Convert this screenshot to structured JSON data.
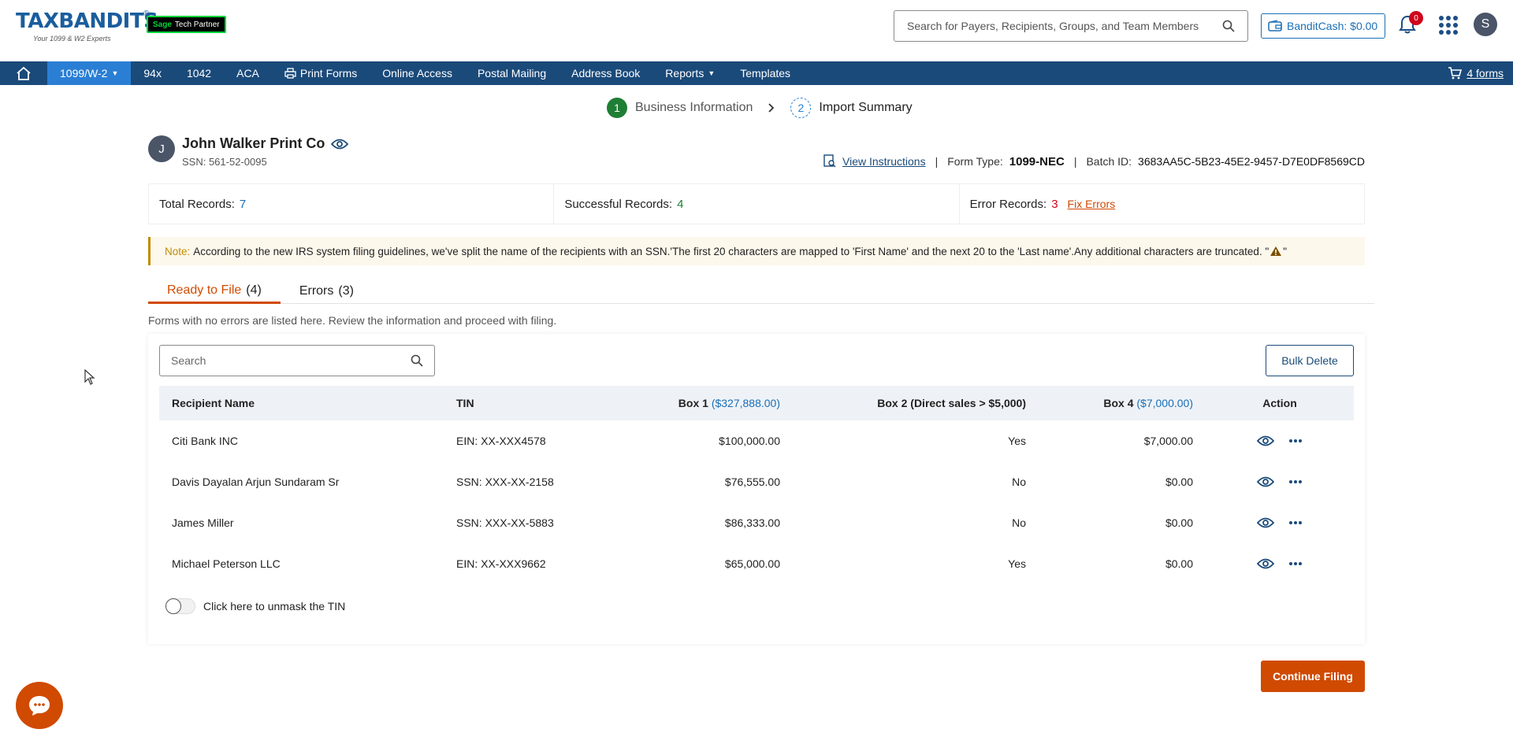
{
  "header": {
    "logo_text": "TAXBANDITS",
    "logo_tagline": "Your 1099 & W2 Experts",
    "partner_badge": {
      "brand": "Sage",
      "text": "Tech Partner"
    },
    "search_placeholder": "Search for Payers, Recipients, Groups, and Team Members",
    "bandit_cash": "BanditCash: $0.00",
    "notification_count": "0",
    "user_initial": "S"
  },
  "nav": {
    "items": [
      {
        "label": "1099/W-2",
        "active": true,
        "dropdown": true
      },
      {
        "label": "94x"
      },
      {
        "label": "1042"
      },
      {
        "label": "ACA"
      },
      {
        "label": "Print Forms",
        "icon": "printer-icon"
      },
      {
        "label": "Online Access"
      },
      {
        "label": "Postal Mailing"
      },
      {
        "label": "Address Book"
      },
      {
        "label": "Reports",
        "dropdown": true
      },
      {
        "label": "Templates"
      }
    ],
    "cart_label": "4 forms"
  },
  "stepper": {
    "steps": [
      {
        "num": "1",
        "label": "Business Information",
        "state": "done"
      },
      {
        "num": "2",
        "label": "Import Summary",
        "state": "current"
      }
    ]
  },
  "business": {
    "initial": "J",
    "name": "John Walker Print Co",
    "ssn": "SSN: 561-52-0095",
    "view_instructions": "View Instructions",
    "form_type_label": "Form Type:",
    "form_type": "1099-NEC",
    "batch_label": "Batch ID:",
    "batch_id": "3683AA5C-5B23-45E2-9457-D7E0DF8569CD"
  },
  "summary": {
    "total_label": "Total Records:",
    "total": "7",
    "success_label": "Successful Records:",
    "success": "4",
    "error_label": "Error Records:",
    "errors": "3",
    "fix_errors": "Fix Errors"
  },
  "note": {
    "label": "Note:",
    "text": "According to the new IRS system filing guidelines, we've split the name of the recipients with an SSN.'The first 20 characters are mapped to 'First Name' and the next 20 to the 'Last name'.Any additional characters are truncated. \"",
    "suffix": "\""
  },
  "tabs": [
    {
      "label": "Ready to File",
      "count": "(4)",
      "active": true
    },
    {
      "label": "Errors",
      "count": "(3)"
    }
  ],
  "help_text": "Forms with no errors are listed here. Review the information and proceed with filing.",
  "table": {
    "search_placeholder": "Search",
    "bulk_delete": "Bulk Delete",
    "headers": {
      "name": "Recipient Name",
      "tin": "TIN",
      "box1": "Box 1",
      "box1_amt": "($327,888.00)",
      "box2": "Box 2 (Direct sales > $5,000)",
      "box4": "Box 4",
      "box4_amt": "($7,000.00)",
      "action": "Action"
    },
    "rows": [
      {
        "name": "Citi Bank INC",
        "tin": "EIN: XX-XXX4578",
        "box1": "$100,000.00",
        "box2": "Yes",
        "box4": "$7,000.00"
      },
      {
        "name": "Davis Dayalan Arjun Sundaram Sr",
        "tin": "SSN: XXX-XX-2158",
        "box1": "$76,555.00",
        "box2": "No",
        "box4": "$0.00"
      },
      {
        "name": "James Miller",
        "tin": "SSN: XXX-XX-5883",
        "box1": "$86,333.00",
        "box2": "No",
        "box4": "$0.00"
      },
      {
        "name": "Michael Peterson LLC",
        "tin": "EIN: XX-XXX9662",
        "box1": "$65,000.00",
        "box2": "Yes",
        "box4": "$0.00"
      }
    ],
    "unmask_label": "Click here to unmask the TIN"
  },
  "continue_label": "Continue Filing",
  "colors": {
    "nav_bg": "#1a4a7a",
    "nav_active": "#2a7fd4",
    "accent_orange": "#d04a02",
    "success_green": "#1e7e34",
    "error_red": "#d0021b"
  }
}
